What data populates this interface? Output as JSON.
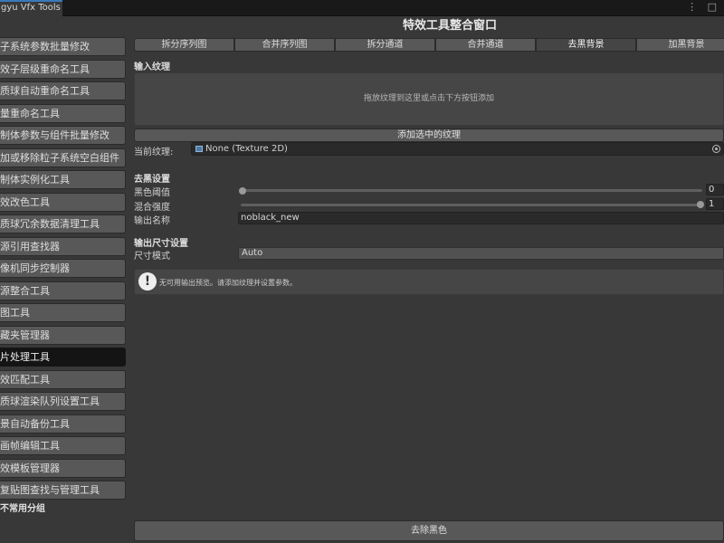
{
  "window": {
    "tab_title": "gyu Vfx Tools",
    "menu_glyph": "⋮ □"
  },
  "page_title": "特效工具整合窗口",
  "sidebar": {
    "items": [
      {
        "label": "子系统参数批量修改",
        "active": false
      },
      {
        "label": "效子层级重命名工具",
        "active": false
      },
      {
        "label": "质球自动重命名工具",
        "active": false
      },
      {
        "label": "量重命名工具",
        "active": false
      },
      {
        "label": "制体参数与组件批量修改",
        "active": false
      },
      {
        "label": "加或移除粒子系统空白组件",
        "active": false
      },
      {
        "label": "制体实例化工具",
        "active": false
      },
      {
        "label": "效改色工具",
        "active": false
      },
      {
        "label": "质球冗余数据清理工具",
        "active": false
      },
      {
        "label": "源引用查找器",
        "active": false
      },
      {
        "label": "像机同步控制器",
        "active": false
      },
      {
        "label": "源整合工具",
        "active": false
      },
      {
        "label": "图工具",
        "active": false
      },
      {
        "label": "藏夹管理器",
        "active": false
      },
      {
        "label": "片处理工具",
        "active": true
      },
      {
        "label": "效匹配工具",
        "active": false
      },
      {
        "label": "质球渲染队列设置工具",
        "active": false
      },
      {
        "label": "景自动备份工具",
        "active": false
      },
      {
        "label": "画帧编辑工具",
        "active": false
      },
      {
        "label": "效模板管理器",
        "active": false
      },
      {
        "label": "复贴图查找与管理工具",
        "active": false
      }
    ],
    "group_label": "不常用分组"
  },
  "toolbar": {
    "tabs": [
      {
        "label": "拆分序列图",
        "active": false
      },
      {
        "label": "合并序列图",
        "active": false
      },
      {
        "label": "拆分通道",
        "active": false
      },
      {
        "label": "合并通道",
        "active": false
      },
      {
        "label": "去黑背景",
        "active": true
      },
      {
        "label": "加黑背景",
        "active": false
      }
    ]
  },
  "input_section": {
    "heading": "输入纹理",
    "dropzone_hint": "拖放纹理到这里或点击下方按钮添加",
    "add_button": "添加选中的纹理",
    "current_label": "当前纹理:",
    "current_value": "None (Texture 2D)"
  },
  "remove_black": {
    "heading": "去黑设置",
    "threshold_label": "黑色阈值",
    "threshold_value": "0",
    "threshold_fraction": 0.0,
    "blend_label": "混合强度",
    "blend_value": "1",
    "blend_fraction": 1.0,
    "output_name_label": "输出名称",
    "output_name_value": "noblack_new"
  },
  "output_size": {
    "heading": "输出尺寸设置",
    "mode_label": "尺寸模式",
    "mode_value": "Auto"
  },
  "help": {
    "message": "无可用输出预览。请添加纹理并设置参数。"
  },
  "action_button": "去除黑色",
  "colors": {
    "accent": "#3a79bb",
    "active_tab": "#141414",
    "button": "#585858",
    "background": "#383838"
  }
}
